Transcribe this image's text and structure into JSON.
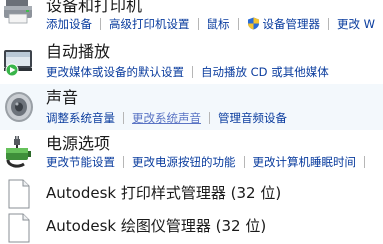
{
  "items": [
    {
      "title": "设备和打印机",
      "icon": "printer-icon",
      "links": [
        "添加设备",
        "高级打印机设置",
        "鼠标",
        "设备管理器",
        "更改 W"
      ]
    },
    {
      "title": "自动播放",
      "icon": "autoplay-icon",
      "links": [
        "更改媒体或设备的默认设置",
        "自动播放 CD 或其他媒体"
      ]
    },
    {
      "title": "声音",
      "icon": "speaker-icon",
      "links": [
        "调整系统音量",
        "更改系统声音",
        "管理音频设备"
      ]
    },
    {
      "title": "电源选项",
      "icon": "power-options-icon",
      "links": [
        "更改节能设置",
        "更改电源按钮的功能",
        "更改计算机睡眠时间"
      ]
    },
    {
      "title": "Autodesk 打印样式管理器 (32 位)",
      "icon": "document-icon"
    },
    {
      "title": "Autodesk 绘图仪管理器 (32 位)",
      "icon": "document-icon"
    }
  ],
  "colors": {
    "link": "#0a3c9e",
    "visited_link": "#5a74c4",
    "highlight": "#f3f8fc"
  }
}
